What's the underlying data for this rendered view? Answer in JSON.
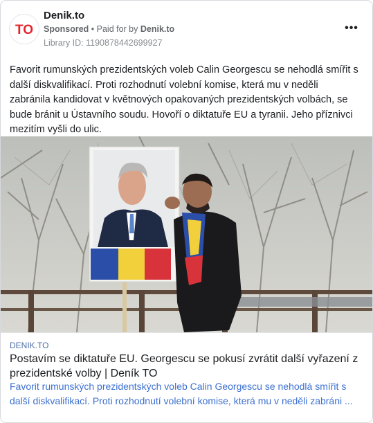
{
  "post": {
    "page_name": "Denik.to",
    "sponsored_label": "Sponsored",
    "separator": " • ",
    "paid_for_label": "Paid for by ",
    "paid_for_name": "Denik.to",
    "library_id": "Library ID: 1190878442699927",
    "more_icon": "more-horizontal-icon",
    "more_glyph": "•••",
    "body_text": "Favorit rumunských prezidentských voleb Calin Georgescu se nehodlá smířit s další diskvalifikací. Proti rozhodnutí volební komise, která mu v neděli zabránila kandidovat v květnových opakovaných prezidentských volbách, se bude bránit u Ústavního soudu. Hovoří o diktatuře EU a tyranii. Jeho příznivci mezitím vyšli do ulic."
  },
  "logo": {
    "icon": "denik-to-logo",
    "text": "TO",
    "color": "#e3262d"
  },
  "link_preview": {
    "domain": "DENIK.TO",
    "title": "Postavím se diktatuře EU. Georgescu se pokusí zvrátit další vyřazení z prezidentské volby | Deník TO",
    "description": "Favorit rumunských prezidentských voleb Calin Georgescu se nehodlá smířit s další diskvalifikací. Proti rozhodnutí volební komise, která mu v neděli zabráni ..."
  },
  "colors": {
    "brand": "#e3262d",
    "link_description": "#3b6fd1",
    "flag_blue": "#2b4ea8",
    "flag_yellow": "#f2d03b",
    "flag_red": "#d8333a"
  }
}
